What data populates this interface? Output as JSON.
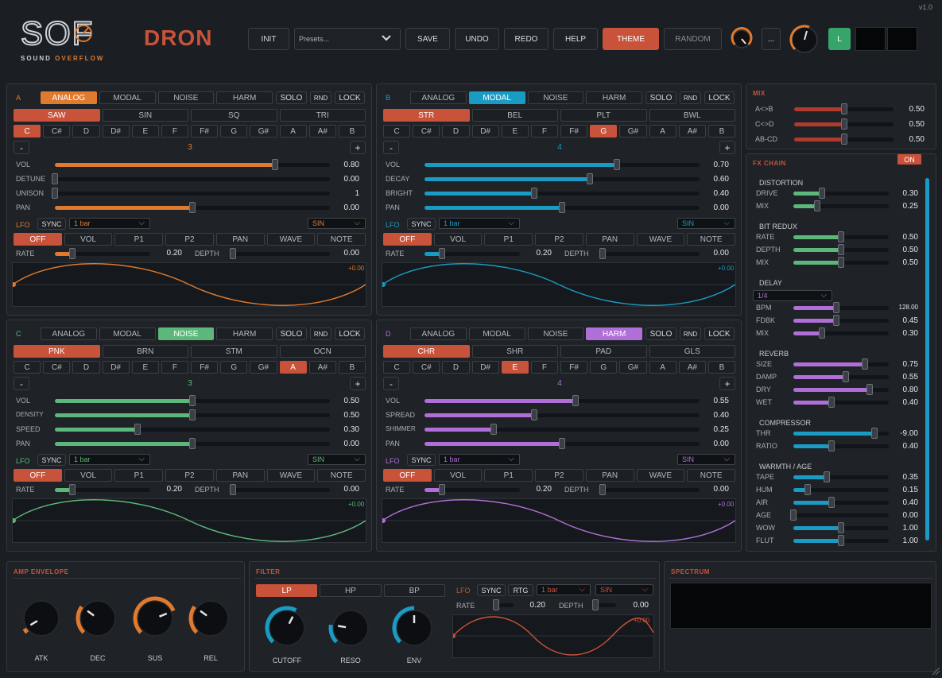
{
  "header": {
    "version": "v1.0",
    "logo_text": "SOF",
    "logo_sub_a": "SOUND",
    "logo_sub_b": "OVERFLOW",
    "title": "DRON",
    "buttons": {
      "init": "INIT",
      "presets": "Presets...",
      "save": "SAVE",
      "undo": "UNDO",
      "redo": "REDO",
      "help": "HELP",
      "theme": "THEME",
      "random": "RANDOM",
      "more": "...",
      "l": "L"
    }
  },
  "colors": {
    "accent": "#c8523a",
    "orange": "#e07a2e",
    "blue": "#1a9bc4",
    "green": "#5cb87a",
    "purple": "#b06fd8",
    "red": "#b03a2e"
  },
  "engines": [
    "ANALOG",
    "MODAL",
    "NOISE",
    "HARM"
  ],
  "notes": [
    "C",
    "C#",
    "D",
    "D#",
    "E",
    "F",
    "F#",
    "G",
    "G#",
    "A",
    "A#",
    "B"
  ],
  "lfo_targets": [
    "OFF",
    "VOL",
    "P1",
    "P2",
    "PAN",
    "WAVE",
    "NOTE"
  ],
  "common": {
    "solo": "SOLO",
    "rnd": "RND",
    "lock": "LOCK",
    "minus": "-",
    "plus": "+",
    "lfo": "LFO",
    "sync": "SYNC",
    "rate": "RATE",
    "depth": "DEPTH"
  },
  "voices": [
    {
      "id": "A",
      "engine": 0,
      "color": "#e07a2e",
      "types": [
        "SAW",
        "SIN",
        "SQ",
        "TRI"
      ],
      "type": 0,
      "note": 0,
      "octave": "3",
      "lfo_div": "1 bar",
      "lfo_wave": "SIN",
      "lfo_rate": "0.20",
      "lfo_depth": "0.00",
      "wave_val": "+0.00",
      "params": [
        {
          "label": "VOL",
          "value": "0.80",
          "pos": 0.8
        },
        {
          "label": "DETUNE",
          "value": "0.00",
          "pos": 0
        },
        {
          "label": "UNISON",
          "value": "1",
          "pos": 0
        },
        {
          "label": "PAN",
          "value": "0.00",
          "pos": 0.5
        }
      ]
    },
    {
      "id": "B",
      "engine": 1,
      "color": "#1a9bc4",
      "types": [
        "STR",
        "BEL",
        "PLT",
        "BWL"
      ],
      "type": 0,
      "note": 7,
      "octave": "4",
      "lfo_div": "1 bar",
      "lfo_wave": "SIN",
      "lfo_rate": "0.20",
      "lfo_depth": "0.00",
      "wave_val": "+0.00",
      "params": [
        {
          "label": "VOL",
          "value": "0.70",
          "pos": 0.7
        },
        {
          "label": "DECAY",
          "value": "0.60",
          "pos": 0.6
        },
        {
          "label": "BRIGHT",
          "value": "0.40",
          "pos": 0.4
        },
        {
          "label": "PAN",
          "value": "0.00",
          "pos": 0.5
        }
      ]
    },
    {
      "id": "C",
      "engine": 2,
      "color": "#5cb87a",
      "types": [
        "PNK",
        "BRN",
        "STM",
        "OCN"
      ],
      "type": 0,
      "note": 9,
      "octave": "3",
      "lfo_div": "1 bar",
      "lfo_wave": "SIN",
      "lfo_rate": "0.20",
      "lfo_depth": "0.00",
      "wave_val": "+0.00",
      "params": [
        {
          "label": "VOL",
          "value": "0.50",
          "pos": 0.5
        },
        {
          "label": "DENSITY",
          "value": "0.50",
          "pos": 0.5
        },
        {
          "label": "SPEED",
          "value": "0.30",
          "pos": 0.3
        },
        {
          "label": "PAN",
          "value": "0.00",
          "pos": 0.5
        }
      ]
    },
    {
      "id": "D",
      "engine": 3,
      "color": "#b06fd8",
      "types": [
        "CHR",
        "SHR",
        "PAD",
        "GLS"
      ],
      "type": 0,
      "note": 4,
      "octave": "4",
      "lfo_div": "1 bar",
      "lfo_wave": "SIN",
      "lfo_rate": "0.20",
      "lfo_depth": "0.00",
      "wave_val": "+0.00",
      "params": [
        {
          "label": "VOL",
          "value": "0.55",
          "pos": 0.55
        },
        {
          "label": "SPREAD",
          "value": "0.40",
          "pos": 0.4
        },
        {
          "label": "SHIMMER",
          "value": "0.25",
          "pos": 0.25
        },
        {
          "label": "PAN",
          "value": "0.00",
          "pos": 0.5
        }
      ]
    }
  ],
  "mix": {
    "title": "MIX",
    "rows": [
      {
        "label": "A<>B",
        "value": "0.50",
        "pos": 0.5
      },
      {
        "label": "C<>D",
        "value": "0.50",
        "pos": 0.5
      },
      {
        "label": "AB-CD",
        "value": "0.50",
        "pos": 0.5
      }
    ]
  },
  "fx": {
    "title": "FX CHAIN",
    "sections": [
      {
        "name": "DISTORTION",
        "state": "ON",
        "on": false,
        "color": "#5cb87a",
        "rows": [
          {
            "label": "DRIVE",
            "value": "0.30",
            "pos": 0.3
          },
          {
            "label": "MIX",
            "value": "0.25",
            "pos": 0.25
          }
        ]
      },
      {
        "name": "BIT REDUX",
        "state": "ON",
        "on": false,
        "color": "#5cb87a",
        "rows": [
          {
            "label": "RATE",
            "value": "0.50",
            "pos": 0.5
          },
          {
            "label": "DEPTH",
            "value": "0.50",
            "pos": 0.5
          },
          {
            "label": "MIX",
            "value": "0.50",
            "pos": 0.5
          }
        ]
      },
      {
        "name": "DELAY",
        "state": "ON",
        "on": true,
        "color": "#b06fd8",
        "div": "1/4",
        "rows": [
          {
            "label": "BPM",
            "value": "128.00",
            "pos": 0.45
          },
          {
            "label": "FDBK",
            "value": "0.45",
            "pos": 0.45
          },
          {
            "label": "MIX",
            "value": "0.30",
            "pos": 0.3
          }
        ]
      },
      {
        "name": "REVERB",
        "state": "ON",
        "on": true,
        "color": "#b06fd8",
        "rows": [
          {
            "label": "SIZE",
            "value": "0.75",
            "pos": 0.75
          },
          {
            "label": "DAMP",
            "value": "0.55",
            "pos": 0.55
          },
          {
            "label": "DRY",
            "value": "0.80",
            "pos": 0.8
          },
          {
            "label": "WET",
            "value": "0.40",
            "pos": 0.4
          }
        ]
      },
      {
        "name": "COMPRESSOR",
        "state": "ON",
        "on": true,
        "color": "#1a9bc4",
        "rows": [
          {
            "label": "THR",
            "value": "-9.00",
            "pos": 0.85
          },
          {
            "label": "RATIO",
            "value": "0.40",
            "pos": 0.4
          }
        ]
      },
      {
        "name": "WARMTH / AGE",
        "state": "ON",
        "on": true,
        "color": "#1a9bc4",
        "rows": [
          {
            "label": "TAPE",
            "value": "0.35",
            "pos": 0.35
          },
          {
            "label": "HUM",
            "value": "0.15",
            "pos": 0.15
          },
          {
            "label": "AIR",
            "value": "0.40",
            "pos": 0.4
          },
          {
            "label": "AGE",
            "value": "0.00",
            "pos": 0
          },
          {
            "label": "WOW",
            "value": "1.00",
            "pos": 0.5
          },
          {
            "label": "FLUT",
            "value": "1.00",
            "pos": 0.5
          }
        ]
      }
    ]
  },
  "amp": {
    "title": "AMP ENVELOPE",
    "knobs": [
      {
        "label": "ATK",
        "value": 0.05
      },
      {
        "label": "DEC",
        "value": 0.3
      },
      {
        "label": "SUS",
        "value": 0.75
      },
      {
        "label": "REL",
        "value": 0.3
      }
    ]
  },
  "filter": {
    "title": "FILTER",
    "modes": [
      "LP",
      "HP",
      "BP"
    ],
    "knobs": [
      {
        "label": "CUTOFF",
        "value": 0.6
      },
      {
        "label": "RESO",
        "value": 0.2
      },
      {
        "label": "ENV",
        "value": 0.5
      }
    ],
    "lfo_div": "1 bar",
    "lfo_wave": "SIN",
    "lfo_rtg": "RTG",
    "lfo_rate": "0.20",
    "lfo_depth": "0.00",
    "wave_val": "+0.00"
  },
  "spectrum": {
    "title": "SPECTRUM"
  }
}
